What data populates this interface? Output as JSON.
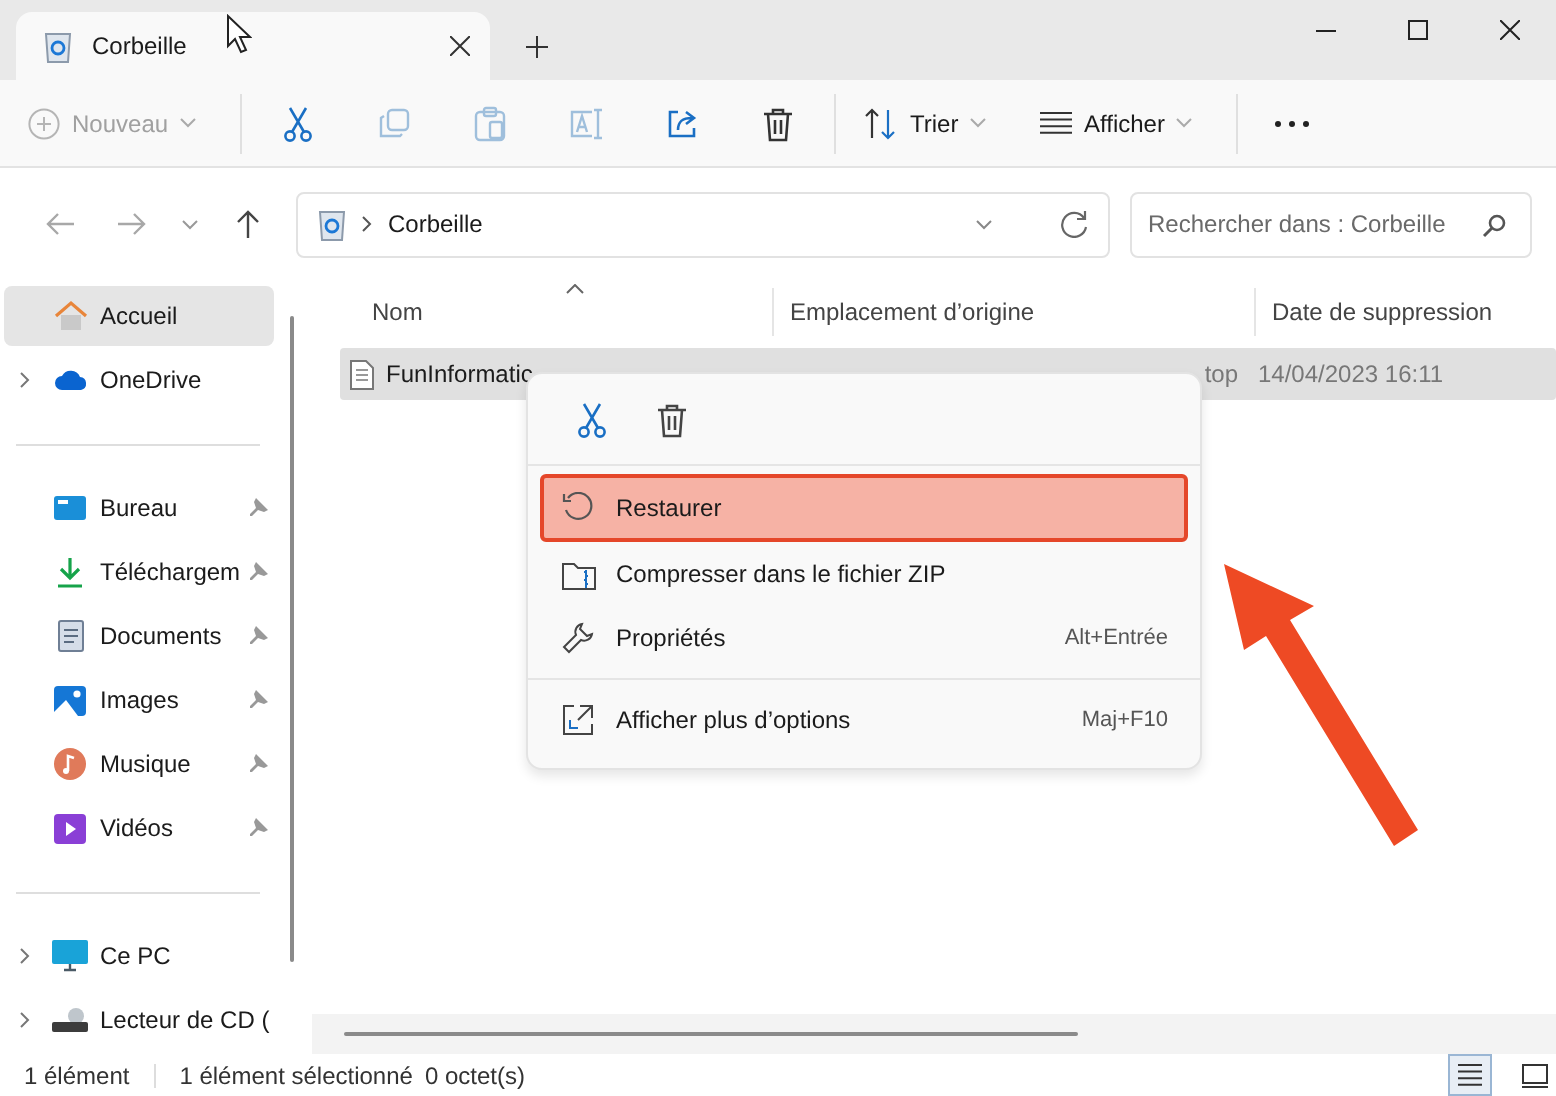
{
  "window": {
    "tab_title": "Corbeille"
  },
  "toolbar": {
    "new_button": {
      "label": "Nouveau",
      "disabled": true
    },
    "actions": [
      {
        "kind": "cut",
        "disabled": false
      },
      {
        "kind": "copy",
        "disabled": true
      },
      {
        "kind": "paste",
        "disabled": true
      },
      {
        "kind": "rename",
        "disabled": true
      },
      {
        "kind": "share",
        "disabled": false
      },
      {
        "kind": "delete",
        "disabled": false
      }
    ],
    "sort_button": "Trier",
    "view_button": "Afficher"
  },
  "address_bar": {
    "path": [
      "Corbeille"
    ],
    "search": {
      "placeholder": "Rechercher dans : Corbeille"
    }
  },
  "sidebar": {
    "sections": [
      {
        "items": [
          {
            "kind": "home",
            "label": "Accueil",
            "selected": true,
            "expandable": false,
            "pinned": false
          },
          {
            "kind": "cloud",
            "label": "OneDrive",
            "selected": false,
            "expandable": true,
            "pinned": false
          }
        ]
      },
      {
        "items": [
          {
            "kind": "desktop",
            "label": "Bureau",
            "selected": false,
            "expandable": false,
            "pinned": true
          },
          {
            "kind": "download",
            "label": "Téléchargem",
            "selected": false,
            "expandable": false,
            "pinned": true
          },
          {
            "kind": "documents",
            "label": "Documents",
            "selected": false,
            "expandable": false,
            "pinned": true
          },
          {
            "kind": "images",
            "label": "Images",
            "selected": false,
            "expandable": false,
            "pinned": true
          },
          {
            "kind": "music",
            "label": "Musique",
            "selected": false,
            "expandable": false,
            "pinned": true
          },
          {
            "kind": "videos",
            "label": "Vidéos",
            "selected": false,
            "expandable": false,
            "pinned": true
          }
        ]
      },
      {
        "items": [
          {
            "kind": "pc",
            "label": "Ce PC",
            "selected": false,
            "expandable": true,
            "pinned": false
          },
          {
            "kind": "cd",
            "label": "Lecteur de CD (",
            "selected": false,
            "expandable": true,
            "pinned": false
          }
        ]
      }
    ]
  },
  "table": {
    "columns": [
      {
        "label": "Nom",
        "sorted": true
      },
      {
        "label": "Emplacement d’origine",
        "sorted": false
      },
      {
        "label": "Date de suppression",
        "sorted": false
      }
    ],
    "rows": [
      {
        "name": "FunInformatic",
        "origin": "top",
        "deleted": "14/04/2023 16:11",
        "selected": true
      }
    ]
  },
  "context_menu": {
    "quick_actions": [
      {
        "kind": "cut"
      },
      {
        "kind": "delete"
      }
    ],
    "groups": [
      {
        "items": [
          {
            "kind": "restore",
            "label": "Restaurer",
            "annotated": true
          },
          {
            "kind": "zip",
            "label": "Compresser dans le fichier ZIP",
            "annotated": false
          },
          {
            "kind": "properties",
            "label": "Propriétés",
            "shortcut": "Alt+Entrée",
            "annotated": false
          }
        ]
      },
      {
        "items": [
          {
            "kind": "more",
            "label": "Afficher plus d’options",
            "shortcut": "Maj+F10",
            "annotated": false
          }
        ]
      }
    ]
  },
  "status_bar": {
    "item_count": "1 élément",
    "selection": "1 élément sélectionné",
    "size": "0 octet(s)",
    "view_modes": [
      {
        "kind": "details",
        "selected": true
      },
      {
        "kind": "tiles",
        "selected": false
      }
    ]
  }
}
